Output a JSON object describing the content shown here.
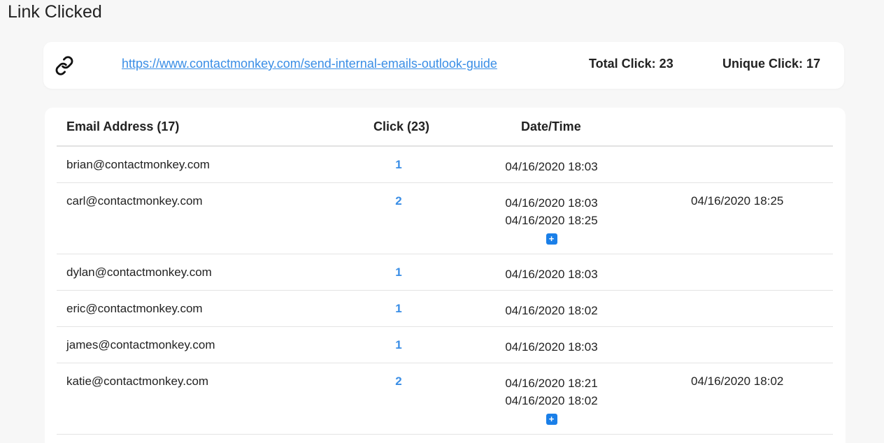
{
  "page": {
    "title": "Link Clicked"
  },
  "link_summary": {
    "icon": "link-icon",
    "url": "https://www.contactmonkey.com/send-internal-emails-outlook-guide",
    "total_click": "Total Click: 23",
    "unique_click": "Unique Click: 17"
  },
  "table": {
    "headers": {
      "email": "Email Address (17)",
      "click": "Click (23)",
      "date": "Date/Time"
    },
    "rows": [
      {
        "email": "brian@contactmonkey.com",
        "clicks": "1",
        "dates": [
          "04/16/2020 18:03"
        ],
        "last": ""
      },
      {
        "email": "carl@contactmonkey.com",
        "clicks": "2",
        "dates": [
          "04/16/2020 18:03",
          "04/16/2020 18:25"
        ],
        "last": "04/16/2020 18:25",
        "expand": "+"
      },
      {
        "email": "dylan@contactmonkey.com",
        "clicks": "1",
        "dates": [
          "04/16/2020 18:03"
        ],
        "last": ""
      },
      {
        "email": "eric@contactmonkey.com",
        "clicks": "1",
        "dates": [
          "04/16/2020 18:02"
        ],
        "last": ""
      },
      {
        "email": "james@contactmonkey.com",
        "clicks": "1",
        "dates": [
          "04/16/2020 18:03"
        ],
        "last": ""
      },
      {
        "email": "katie@contactmonkey.com",
        "clicks": "2",
        "dates": [
          "04/16/2020 18:21",
          "04/16/2020 18:02"
        ],
        "last": "04/16/2020 18:02",
        "expand": "+"
      }
    ]
  },
  "colors": {
    "accent": "#3a8ee6",
    "expand_button": "#1a7fe8",
    "background": "#f7f7f7"
  }
}
